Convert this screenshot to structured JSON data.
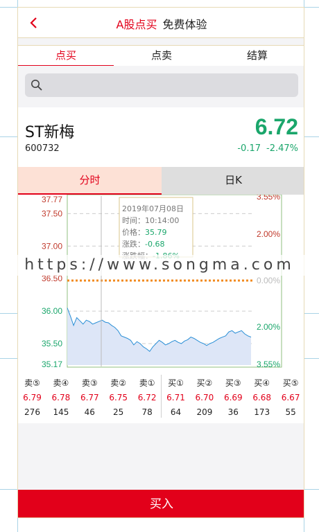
{
  "header": {
    "title_red": "A股点买",
    "title_black": "免费体验",
    "back_icon": "chevron-left-icon"
  },
  "tabs": [
    {
      "label": "点买",
      "active": true
    },
    {
      "label": "点卖",
      "active": false
    },
    {
      "label": "结算",
      "active": false
    }
  ],
  "search": {
    "placeholder": "",
    "icon": "search-icon"
  },
  "quote": {
    "name": "ST新梅",
    "code": "600732",
    "price": "6.72",
    "change": "-0.17",
    "change_pct": "-2.47%"
  },
  "chart_tabs": [
    {
      "label": "分时",
      "active": true
    },
    {
      "label": "日K",
      "active": false
    }
  ],
  "chart_data": {
    "type": "area",
    "y_left_ticks": [
      "37.77",
      "37.50",
      "37.00",
      "36.50",
      "36.00",
      "35.50",
      "35.17"
    ],
    "y_right_ticks": [
      "3.55%",
      "2.00%",
      "0.00%",
      "2.00%",
      "3.55%"
    ],
    "ylim": [
      35.17,
      37.77
    ],
    "reference_price": 36.47,
    "series": [
      {
        "values": [
          36.05,
          35.92,
          35.78,
          35.9,
          35.85,
          35.8,
          35.86,
          35.84,
          35.8,
          35.82,
          35.84,
          35.86,
          35.83,
          35.82,
          35.78,
          35.75,
          35.7,
          35.62,
          35.6,
          35.58,
          35.55,
          35.48,
          35.53,
          35.5,
          35.45,
          35.42,
          35.38,
          35.45,
          35.5,
          35.55,
          35.52,
          35.48,
          35.5,
          35.53,
          35.55,
          35.52,
          35.5,
          35.54,
          35.56,
          35.6,
          35.58,
          35.55,
          35.52,
          35.5,
          35.47,
          35.5,
          35.52,
          35.55,
          35.58,
          35.6,
          35.62,
          35.68,
          35.7,
          35.66,
          35.68,
          35.7,
          35.65,
          35.62,
          35.6
        ]
      }
    ],
    "tooltip": {
      "date": "2019年07月08日",
      "time_label": "时间：",
      "time": "10:14:00",
      "price_label": "价格：",
      "price": "35.79",
      "change_label": "涨跌：",
      "change": "-0.68",
      "pct_label": "涨跌幅：",
      "pct": "-1.86%"
    }
  },
  "order_book": {
    "asks": [
      {
        "label": "卖⑤",
        "price": "6.79",
        "volume": "276"
      },
      {
        "label": "卖④",
        "price": "6.78",
        "volume": "145"
      },
      {
        "label": "卖③",
        "price": "6.77",
        "volume": "46"
      },
      {
        "label": "卖②",
        "price": "6.75",
        "volume": "25"
      },
      {
        "label": "卖①",
        "price": "6.72",
        "volume": "78"
      }
    ],
    "bids": [
      {
        "label": "买①",
        "price": "6.71",
        "volume": "64"
      },
      {
        "label": "买②",
        "price": "6.70",
        "volume": "209"
      },
      {
        "label": "买③",
        "price": "6.69",
        "volume": "36"
      },
      {
        "label": "买④",
        "price": "6.68",
        "volume": "173"
      },
      {
        "label": "买⑤",
        "price": "6.67",
        "volume": "55"
      }
    ]
  },
  "buy_button": "买入",
  "watermark": "https://www.songma.com",
  "colors": {
    "accent": "#e2001a",
    "down": "#1aa66b",
    "line": "#2a8fd6",
    "fill": "#dde6f7"
  }
}
